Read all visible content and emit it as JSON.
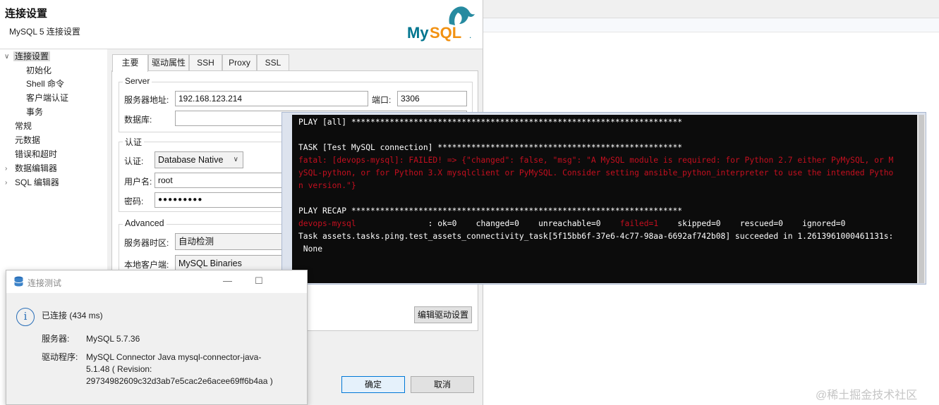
{
  "dialog": {
    "title": "连接设置",
    "subtitle": "MySQL 5 连接设置",
    "logo_text": "MySQL",
    "logo_dot": ".",
    "tree": [
      {
        "label": "连接设置",
        "expanded": true,
        "selected": true
      },
      {
        "label": "初始化"
      },
      {
        "label": "Shell 命令"
      },
      {
        "label": "客户端认证"
      },
      {
        "label": "事务"
      },
      {
        "label": "常规"
      },
      {
        "label": "元数据"
      },
      {
        "label": "错误和超时"
      },
      {
        "label": "数据编辑器"
      },
      {
        "label": "SQL 编辑器"
      }
    ],
    "tabs": [
      "主要",
      "驱动属性",
      "SSH",
      "Proxy",
      "SSL"
    ],
    "server": {
      "group_title": "Server",
      "host_label": "服务器地址:",
      "host_value": "192.168.123.214",
      "port_label": "端口:",
      "port_value": "3306",
      "database_label": "数据库:",
      "database_value": ""
    },
    "auth": {
      "group_title": "认证",
      "auth_label": "认证:",
      "auth_value": "Database Native",
      "user_label": "用户名:",
      "user_value": "root",
      "password_label": "密码:",
      "password_value": "●●●●●●●●●"
    },
    "advanced": {
      "group_title": "Advanced",
      "timezone_label": "服务器时区:",
      "timezone_value": "自动检测",
      "client_label": "本地客户端:",
      "client_value": "MySQL Binaries"
    },
    "edit_driver_button": "编辑驱动设置",
    "ok_button": "确定",
    "cancel_button": "取消"
  },
  "terminal": {
    "lines": [
      {
        "text": "PLAY [all] *********************************************************************",
        "color": "white"
      },
      {
        "text": "",
        "color": "white"
      },
      {
        "text": "TASK [Test MySQL connection] ***************************************************",
        "color": "white"
      },
      {
        "text": "fatal: [devops-mysql]: FAILED! => {\"changed\": false, \"msg\": \"A MySQL module is required: for Python 2.7 either PyMySQL, or M",
        "color": "red"
      },
      {
        "text": "ySQL-python, or for Python 3.X mysqlclient or PyMySQL. Consider setting ansible_python_interpreter to use the intended Pytho",
        "color": "red"
      },
      {
        "text": "n version.\"}",
        "color": "red"
      },
      {
        "text": "",
        "color": "white"
      },
      {
        "text": "PLAY RECAP *********************************************************************",
        "color": "white"
      }
    ],
    "recap": {
      "host": "devops-mysql",
      "ok": ": ok=0    changed=0    unreachable=0    ",
      "failed": "failed=1",
      "rest": "    skipped=0    rescued=0    ignored=0"
    },
    "task_line": "Task assets.tasks.ping.test_assets_connectivity_task[5f15bb6f-37e6-4c77-98aa-6692af742b08] succeeded in 1.2613961000461131s:",
    "result_line": " None"
  },
  "popup": {
    "title": "连接测试",
    "status": "已连接 (434 ms)",
    "server_label": "服务器:",
    "server_value": "MySQL 5.7.36",
    "driver_label": "驱动程序:",
    "driver_value_line1": "MySQL Connector Java mysql-connector-java-",
    "driver_value_line2": "5.1.48 ( Revision:",
    "driver_value_line3": "29734982609c32d3ab7e5cac2e6acee69ff6b4aa )",
    "minimize_symbol": "—",
    "maximize_symbol": "☐"
  },
  "watermark": "@稀土掘金技术社区",
  "colors": {
    "terminal_bg": "#0c0c0c",
    "terminal_red": "#c50f1f",
    "mysql_blue": "#00758f",
    "mysql_orange": "#f29111",
    "info_blue": "#2a6fb8",
    "primary_border": "#0078d7"
  }
}
